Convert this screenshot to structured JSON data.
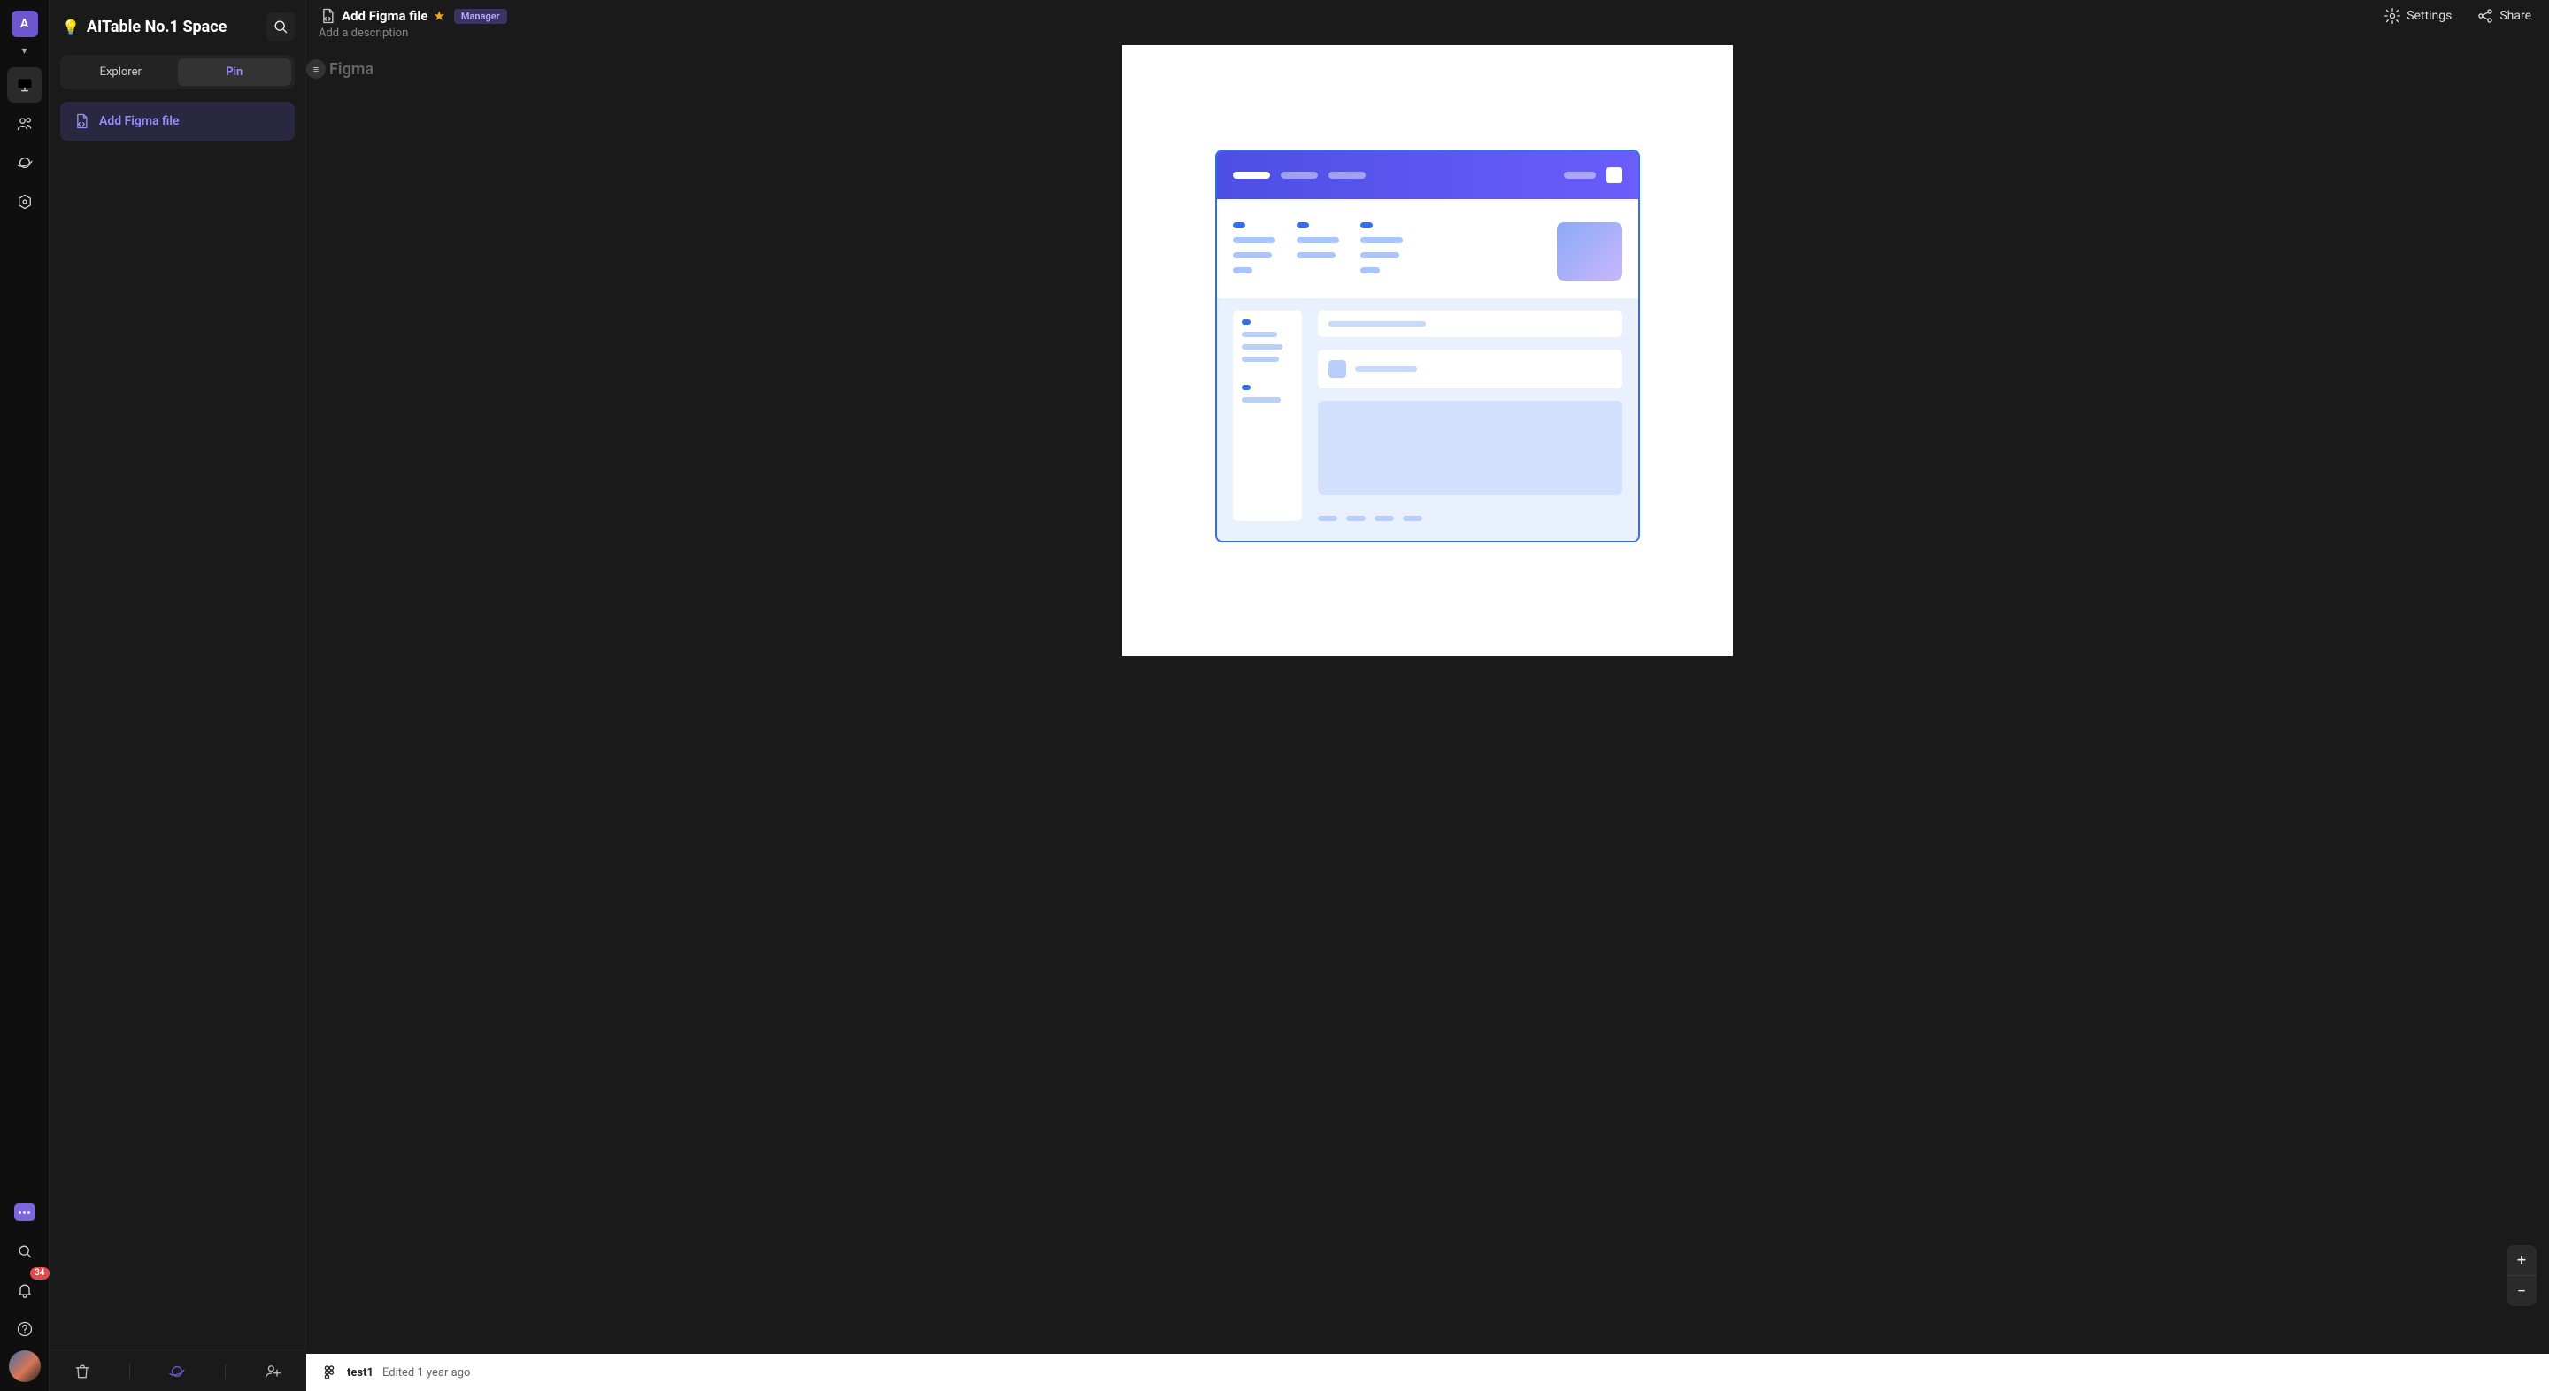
{
  "rail": {
    "avatar_letter": "A",
    "notif_count": "34"
  },
  "sidebar": {
    "space_name": "AITable No.1 Space",
    "tabs": {
      "explorer": "Explorer",
      "pin": "Pin"
    },
    "pins": [
      {
        "label": "Add Figma file"
      }
    ]
  },
  "header": {
    "file_title": "Add Figma file",
    "role_tag": "Manager",
    "description_placeholder": "Add a description",
    "settings_label": "Settings",
    "share_label": "Share"
  },
  "canvas": {
    "back_label": "Figma"
  },
  "status": {
    "file_name": "test1",
    "edited_text": "Edited 1 year ago"
  },
  "zoom": {
    "in": "+",
    "out": "−"
  }
}
